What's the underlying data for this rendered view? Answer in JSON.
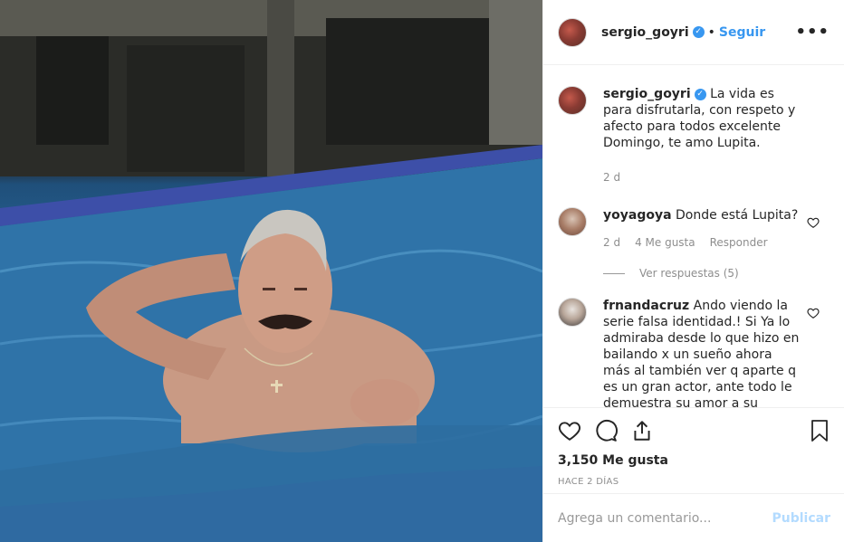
{
  "post": {
    "photo_alt": "",
    "username": "sergio_goyri",
    "verified": true,
    "follow_label": "Seguir",
    "more_icon": "more-options-icon",
    "caption": "La vida es para disfrutarla, con respeto y afecto para todos excelente Domingo, te amo Lupita.",
    "caption_age": "2 d"
  },
  "comments": [
    {
      "username": "yoyagoya",
      "text": "Donde está Lupita?",
      "age": "2 d",
      "likes": "4 Me gusta",
      "reply_label": "Responder",
      "view_replies": "Ver respuestas (5)"
    },
    {
      "username": "frnandacruz",
      "text": "Ando viendo la serie falsa identidad.! Si Ya lo admiraba desde lo que hizo en bailando x un sueño ahora más al también ver q aparte q es un gran actor, ante todo le demuestra su amor a su esposa! Dios lo bendiga"
    }
  ],
  "footer": {
    "likes_count": "3,150 Me gusta",
    "posted_ago": "HACE 2 DÍAS",
    "comment_placeholder": "Agrega un comentario...",
    "publish_label": "Publicar"
  },
  "colors": {
    "accent": "#3897f0",
    "publish_disabled": "#b3dbff",
    "muted": "#8e8e8e"
  }
}
